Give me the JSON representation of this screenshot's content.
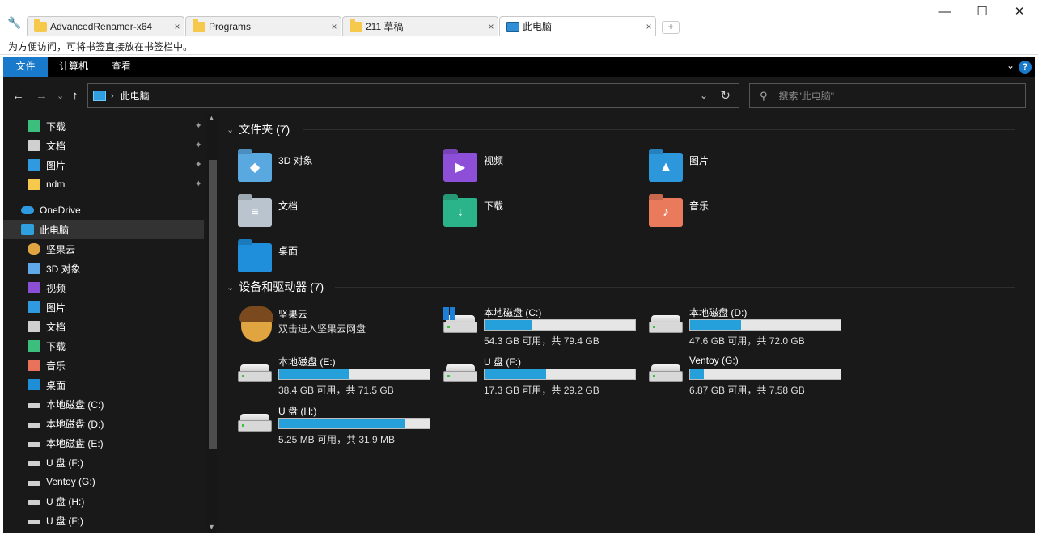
{
  "browser": {
    "tabs": [
      {
        "label": "AdvancedRenamer-x64",
        "close": "×"
      },
      {
        "label": "Programs",
        "close": "×"
      },
      {
        "label": "211 草稿",
        "close": "×"
      },
      {
        "label": "此电脑",
        "close": "×"
      }
    ],
    "new_tab": "+",
    "window_controls": {
      "minimize": "—",
      "maximize": "☐",
      "close": "✕"
    },
    "bookmark_hint": "为方便访问，可将书签直接放在书签栏中。"
  },
  "ribbon": {
    "tabs": [
      "文件",
      "计算机",
      "查看"
    ],
    "expand_glyph": "⌄",
    "help_glyph": "?"
  },
  "nav": {
    "back": "←",
    "forward": "→",
    "recent": "⌄",
    "up": "↑",
    "address_sep": "›",
    "address": "此电脑",
    "dropdown": "⌄",
    "refresh": "↻",
    "search_placeholder": "搜索\"此电脑\""
  },
  "sidebar": {
    "quick_access": [
      {
        "label": "下载",
        "icon": "download-icon",
        "color": "#3cbf7c",
        "pinned": true
      },
      {
        "label": "文档",
        "icon": "document-icon",
        "color": "#d0d0d0",
        "pinned": true
      },
      {
        "label": "图片",
        "icon": "pictures-icon",
        "color": "#2f9ae0",
        "pinned": true
      },
      {
        "label": "ndm",
        "icon": "folder-icon",
        "color": "#f6c94c",
        "pinned": true
      }
    ],
    "onedrive": {
      "label": "OneDrive",
      "color": "#2f9ae0"
    },
    "this_pc": {
      "label": "此电脑",
      "color": "#2f9fe0"
    },
    "pc_children": [
      {
        "label": "坚果云",
        "icon": "nutstore-icon",
        "color": "#e0a440"
      },
      {
        "label": "3D 对象",
        "icon": "3d-objects-icon",
        "color": "#5fa9e8"
      },
      {
        "label": "视频",
        "icon": "videos-icon",
        "color": "#8b4fd6"
      },
      {
        "label": "图片",
        "icon": "pictures-icon",
        "color": "#2f9ae0"
      },
      {
        "label": "文档",
        "icon": "document-icon",
        "color": "#d0d0d0"
      },
      {
        "label": "下载",
        "icon": "download-icon",
        "color": "#3cbf7c"
      },
      {
        "label": "音乐",
        "icon": "music-icon",
        "color": "#e8735a"
      },
      {
        "label": "桌面",
        "icon": "desktop-icon",
        "color": "#1e8fd6"
      },
      {
        "label": "本地磁盘 (C:)",
        "icon": "drive-icon",
        "color": "#d0d0d0"
      },
      {
        "label": "本地磁盘 (D:)",
        "icon": "drive-icon",
        "color": "#d0d0d0"
      },
      {
        "label": "本地磁盘 (E:)",
        "icon": "drive-icon",
        "color": "#d0d0d0"
      },
      {
        "label": "U 盘 (F:)",
        "icon": "drive-icon",
        "color": "#d0d0d0"
      },
      {
        "label": "Ventoy (G:)",
        "icon": "drive-icon",
        "color": "#d0d0d0"
      },
      {
        "label": "U 盘 (H:)",
        "icon": "drive-icon",
        "color": "#d0d0d0"
      },
      {
        "label": "U 盘 (F:)",
        "icon": "drive-icon",
        "color": "#d0d0d0"
      }
    ],
    "pin_glyph": "📌"
  },
  "content": {
    "folders_header": "文件夹 (7)",
    "folders": [
      {
        "label": "3D 对象",
        "icon": "3d-objects-icon",
        "color": "#5aa8e0",
        "glyph": "◆"
      },
      {
        "label": "视频",
        "icon": "videos-icon",
        "color": "#8e4fd8",
        "glyph": "▶"
      },
      {
        "label": "图片",
        "icon": "pictures-icon",
        "color": "#2d97dc",
        "glyph": "▲"
      },
      {
        "label": "文档",
        "icon": "document-icon",
        "color": "#b9c4cf",
        "glyph": "≡"
      },
      {
        "label": "下载",
        "icon": "download-icon",
        "color": "#2bb38a",
        "glyph": "↓"
      },
      {
        "label": "音乐",
        "icon": "music-icon",
        "color": "#ea7a5c",
        "glyph": "♪"
      },
      {
        "label": "桌面",
        "icon": "desktop-icon",
        "color": "#1f8fdc",
        "glyph": ""
      }
    ],
    "drives_header": "设备和驱动器 (7)",
    "nutstore": {
      "name": "坚果云",
      "subtitle": "双击进入坚果云网盘"
    },
    "drives": [
      {
        "name": "本地磁盘 (C:)",
        "free_text": "54.3 GB 可用，共 79.4 GB",
        "used_fraction": 0.316,
        "system": true
      },
      {
        "name": "本地磁盘 (D:)",
        "free_text": "47.6 GB 可用，共 72.0 GB",
        "used_fraction": 0.339,
        "system": false
      },
      {
        "name": "本地磁盘 (E:)",
        "free_text": "38.4 GB 可用，共 71.5 GB",
        "used_fraction": 0.463,
        "system": false
      },
      {
        "name": "U 盘 (F:)",
        "free_text": "17.3 GB 可用，共 29.2 GB",
        "used_fraction": 0.408,
        "system": false
      },
      {
        "name": "Ventoy (G:)",
        "free_text": "6.87 GB 可用，共 7.58 GB",
        "used_fraction": 0.094,
        "system": false
      },
      {
        "name": "U 盘 (H:)",
        "free_text": "5.25 MB 可用，共 31.9 MB",
        "used_fraction": 0.835,
        "system": false
      }
    ],
    "collapse_glyph": "⌄"
  },
  "colors": {
    "accent": "#1979ca",
    "drive_fill": "#26a0da",
    "background": "#191919"
  }
}
